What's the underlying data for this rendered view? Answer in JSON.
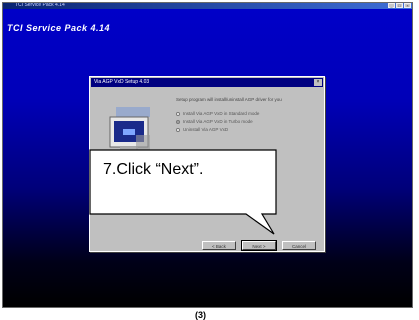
{
  "window": {
    "title": "TCI Service Pack 4.14",
    "controls": [
      "_",
      "□",
      "×"
    ]
  },
  "desktop": {
    "title": "TCI Service Pack 4.14"
  },
  "setup_dialog": {
    "title": "Via AGP VxD Setup 4.03",
    "prompt": "Setup program will install/uninstall AGP driver for you",
    "options": [
      {
        "label": "Install Via AGP VxD in Standard mode",
        "selected": false
      },
      {
        "label": "Install Via AGP VxD in Turbo mode",
        "selected": true
      },
      {
        "label": "Uninstall Via AGP VxD",
        "selected": false
      }
    ],
    "buttons": {
      "back": "< Back",
      "next": "Next >",
      "cancel": "Cancel"
    }
  },
  "callout": {
    "text": "7.Click “Next”."
  },
  "figure_label": "(3)",
  "colors": {
    "desktop_top": "#0000c8",
    "desktop_bottom": "#000000",
    "dialog_face": "#c0c0c0",
    "title_active": "#000080"
  }
}
